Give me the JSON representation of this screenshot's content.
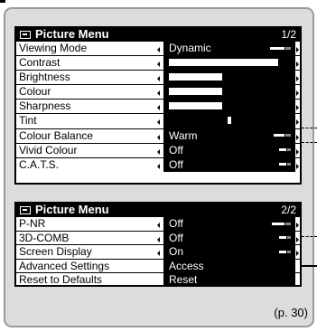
{
  "panel1": {
    "title": "Picture Menu",
    "page": "1/2",
    "rows": [
      {
        "label": "Viewing Mode",
        "value": "Dynamic"
      },
      {
        "label": "Contrast",
        "value": "",
        "bar_level": 0.92
      },
      {
        "label": "Brightness",
        "value": "",
        "bar_level": 0.45
      },
      {
        "label": "Colour",
        "value": "",
        "bar_level": 0.45
      },
      {
        "label": "Sharpness",
        "value": "",
        "bar_level": 0.45
      },
      {
        "label": "Tint",
        "value": "",
        "tint_position": 0.5
      },
      {
        "label": "Colour Balance",
        "value": "Warm"
      },
      {
        "label": "Vivid Colour",
        "value": "Off"
      },
      {
        "label": "C.A.T.S.",
        "value": "Off"
      }
    ]
  },
  "panel2": {
    "title": "Picture Menu",
    "page": "2/2",
    "rows": [
      {
        "label": "P-NR",
        "value": "Off"
      },
      {
        "label": "3D-COMB",
        "value": "Off"
      },
      {
        "label": "Screen Display",
        "value": "On"
      },
      {
        "label": "Advanced Settings",
        "value": "Access"
      },
      {
        "label": "Reset to Defaults",
        "value": "Reset"
      }
    ]
  },
  "page_reference": "(p. 30)",
  "icons": {
    "header_icon": "menu-icon",
    "arrow_left": "arrow-left-icon",
    "arrow_right": "arrow-right-icon"
  },
  "colors": {
    "frame_bg": "#dcdcdc",
    "panel_header_bg": "#000000",
    "value_bg": "#000000",
    "value_text": "#ffffff"
  }
}
